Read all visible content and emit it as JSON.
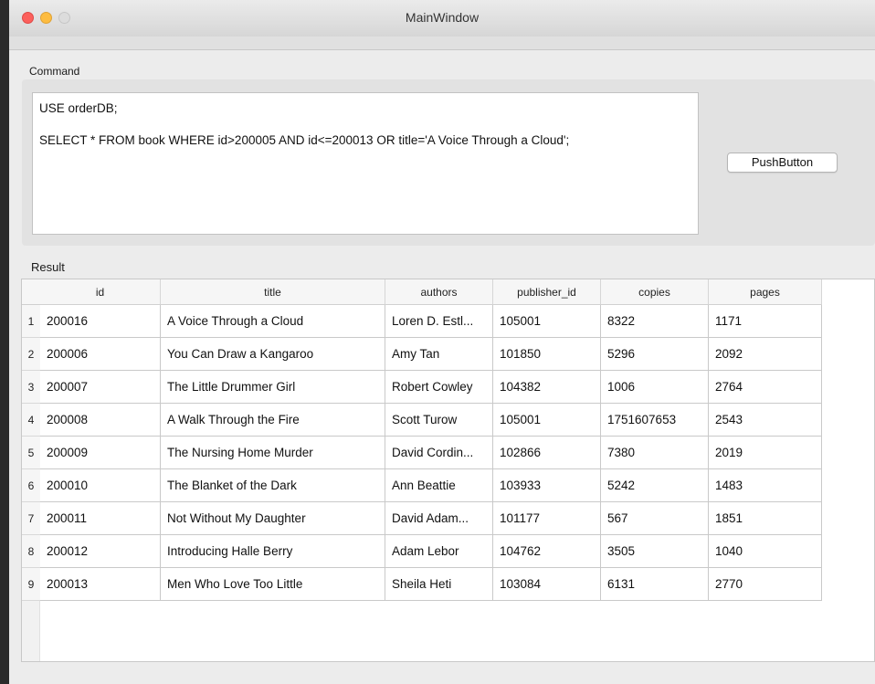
{
  "window": {
    "title": "MainWindow"
  },
  "command": {
    "label": "Command",
    "line1": "USE orderDB;",
    "line2": "SELECT * FROM book WHERE id>200005 AND id<=200013 OR title='A Voice Through a Cloud';"
  },
  "push_button": {
    "label": "PushButton"
  },
  "result": {
    "label": "Result",
    "columns": [
      "id",
      "title",
      "authors",
      "publisher_id",
      "copies",
      "pages"
    ],
    "rows": [
      {
        "num": "1",
        "id": "200016",
        "title": "A Voice Through a Cloud",
        "authors": "Loren D. Estl...",
        "publisher_id": "105001",
        "copies": "8322",
        "pages": "1171"
      },
      {
        "num": "2",
        "id": "200006",
        "title": "You Can Draw a Kangaroo",
        "authors": "Amy Tan",
        "publisher_id": "101850",
        "copies": "5296",
        "pages": "2092"
      },
      {
        "num": "3",
        "id": "200007",
        "title": "The Little Drummer Girl",
        "authors": "Robert Cowley",
        "publisher_id": "104382",
        "copies": "1006",
        "pages": "2764"
      },
      {
        "num": "4",
        "id": "200008",
        "title": "A Walk Through the Fire",
        "authors": "Scott Turow",
        "publisher_id": "105001",
        "copies": "1751607653",
        "pages": "2543"
      },
      {
        "num": "5",
        "id": "200009",
        "title": "The Nursing Home Murder",
        "authors": "David Cordin...",
        "publisher_id": "102866",
        "copies": "7380",
        "pages": "2019"
      },
      {
        "num": "6",
        "id": "200010",
        "title": "The Blanket of the Dark",
        "authors": "Ann Beattie",
        "publisher_id": "103933",
        "copies": "5242",
        "pages": "1483"
      },
      {
        "num": "7",
        "id": "200011",
        "title": "Not Without My Daughter",
        "authors": "David Adam...",
        "publisher_id": "101177",
        "copies": "567",
        "pages": "1851"
      },
      {
        "num": "8",
        "id": "200012",
        "title": "Introducing Halle Berry",
        "authors": "Adam Lebor",
        "publisher_id": "104762",
        "copies": "3505",
        "pages": "1040"
      },
      {
        "num": "9",
        "id": "200013",
        "title": "Men Who Love Too Little",
        "authors": "Sheila Heti",
        "publisher_id": "103084",
        "copies": "6131",
        "pages": "2770"
      }
    ]
  }
}
